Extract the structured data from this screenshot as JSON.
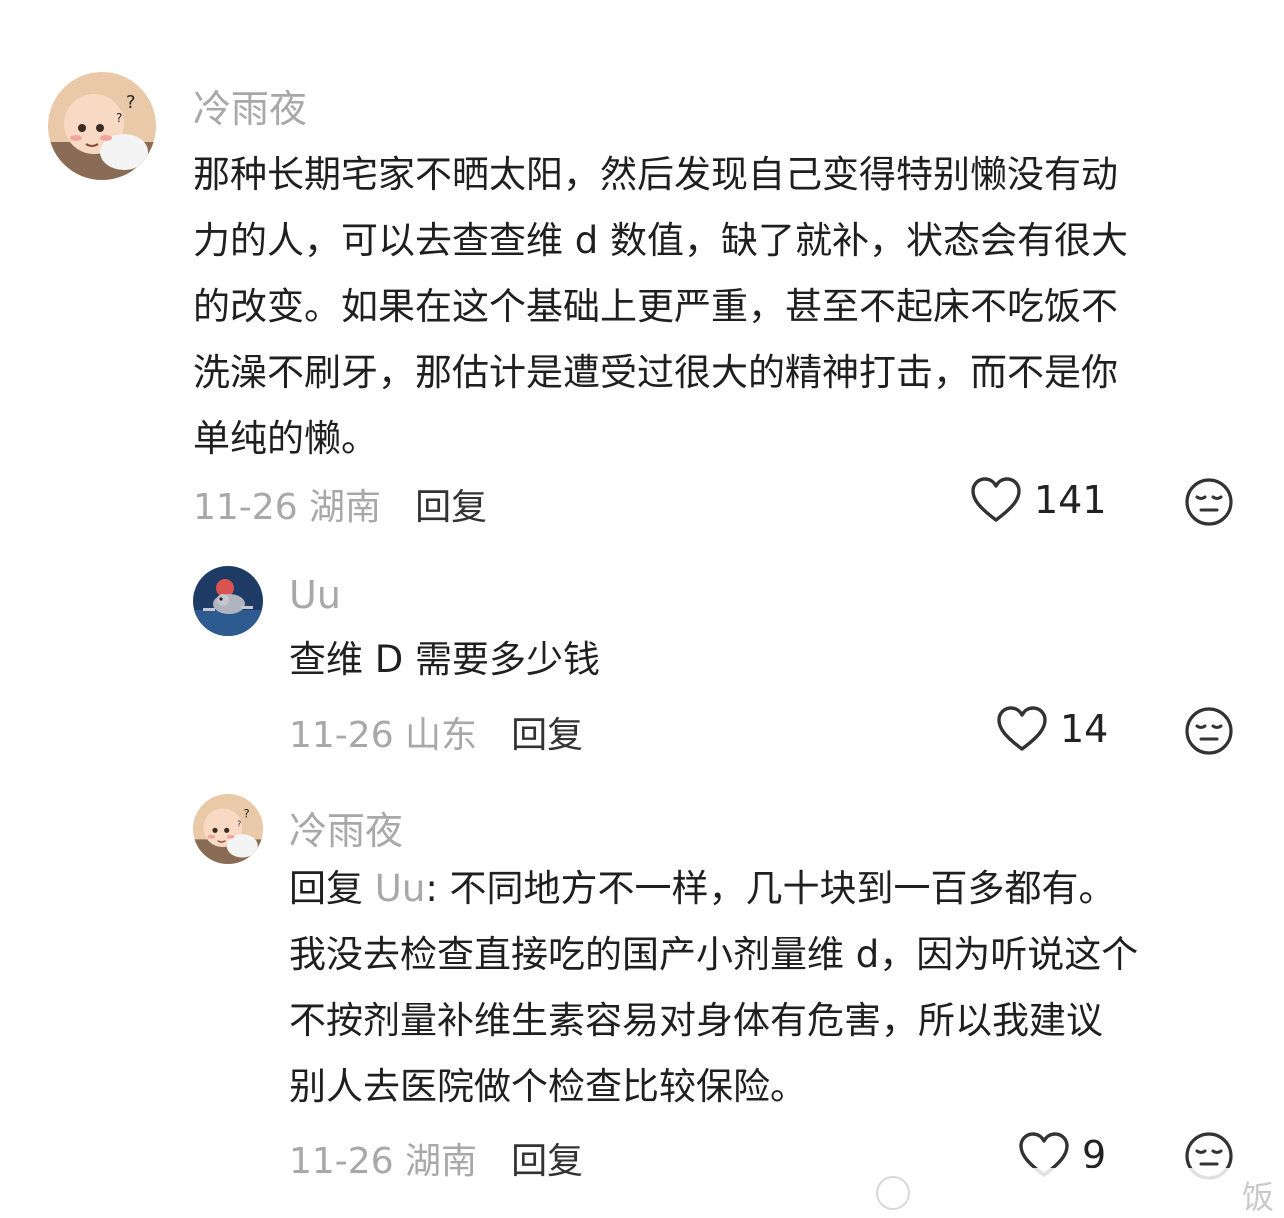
{
  "comments": [
    {
      "username": "冷雨夜",
      "avatar_icon": "cartoon-baby-avatar",
      "text_lines": [
        "那种长期宅家不晒太阳，然后发现自己变得特别懒没有动",
        "力的人，可以去查查维 d 数值，缺了就补，状态会有很大",
        "的改变。如果在这个基础上更严重，甚至不起床不吃饭不",
        "洗澡不刷牙，那估计是遭受过很大的精神打击，而不是你",
        "单纯的懒。"
      ],
      "date_location": "11-26 湖南",
      "reply_label": "回复",
      "like_count": "141",
      "like_icon": "heart-outline-icon",
      "react_icon": "neutral-face-icon"
    },
    {
      "username": "Uu",
      "avatar_icon": "cartoon-mouse-avatar",
      "text_lines": [
        "查维 D 需要多少钱"
      ],
      "date_location": "11-26 山东",
      "reply_label": "回复",
      "like_count": "14",
      "like_icon": "heart-outline-icon",
      "react_icon": "neutral-face-icon"
    },
    {
      "username": "冷雨夜",
      "avatar_icon": "cartoon-baby-avatar",
      "reply_prefix": "回复 ",
      "reply_to": "Uu",
      "first_line_rest": ": 不同地方不一样，几十块到一百多都有。",
      "text_lines": [
        "我没去检查直接吃的国产小剂量维 d，因为听说这个",
        "不按剂量补维生素容易对身体有危害，所以我建议",
        "别人去医院做个检查比较保险。"
      ],
      "date_location": "11-26 湖南",
      "reply_label": "回复",
      "like_count": "9",
      "like_icon": "heart-outline-icon",
      "react_icon": "neutral-face-icon"
    }
  ],
  "watermark": {
    "text": "饭"
  },
  "colors": {
    "text": "#1f1f1f",
    "muted": "#a8a8a8",
    "icon": "#333333",
    "background": "#ffffff"
  }
}
